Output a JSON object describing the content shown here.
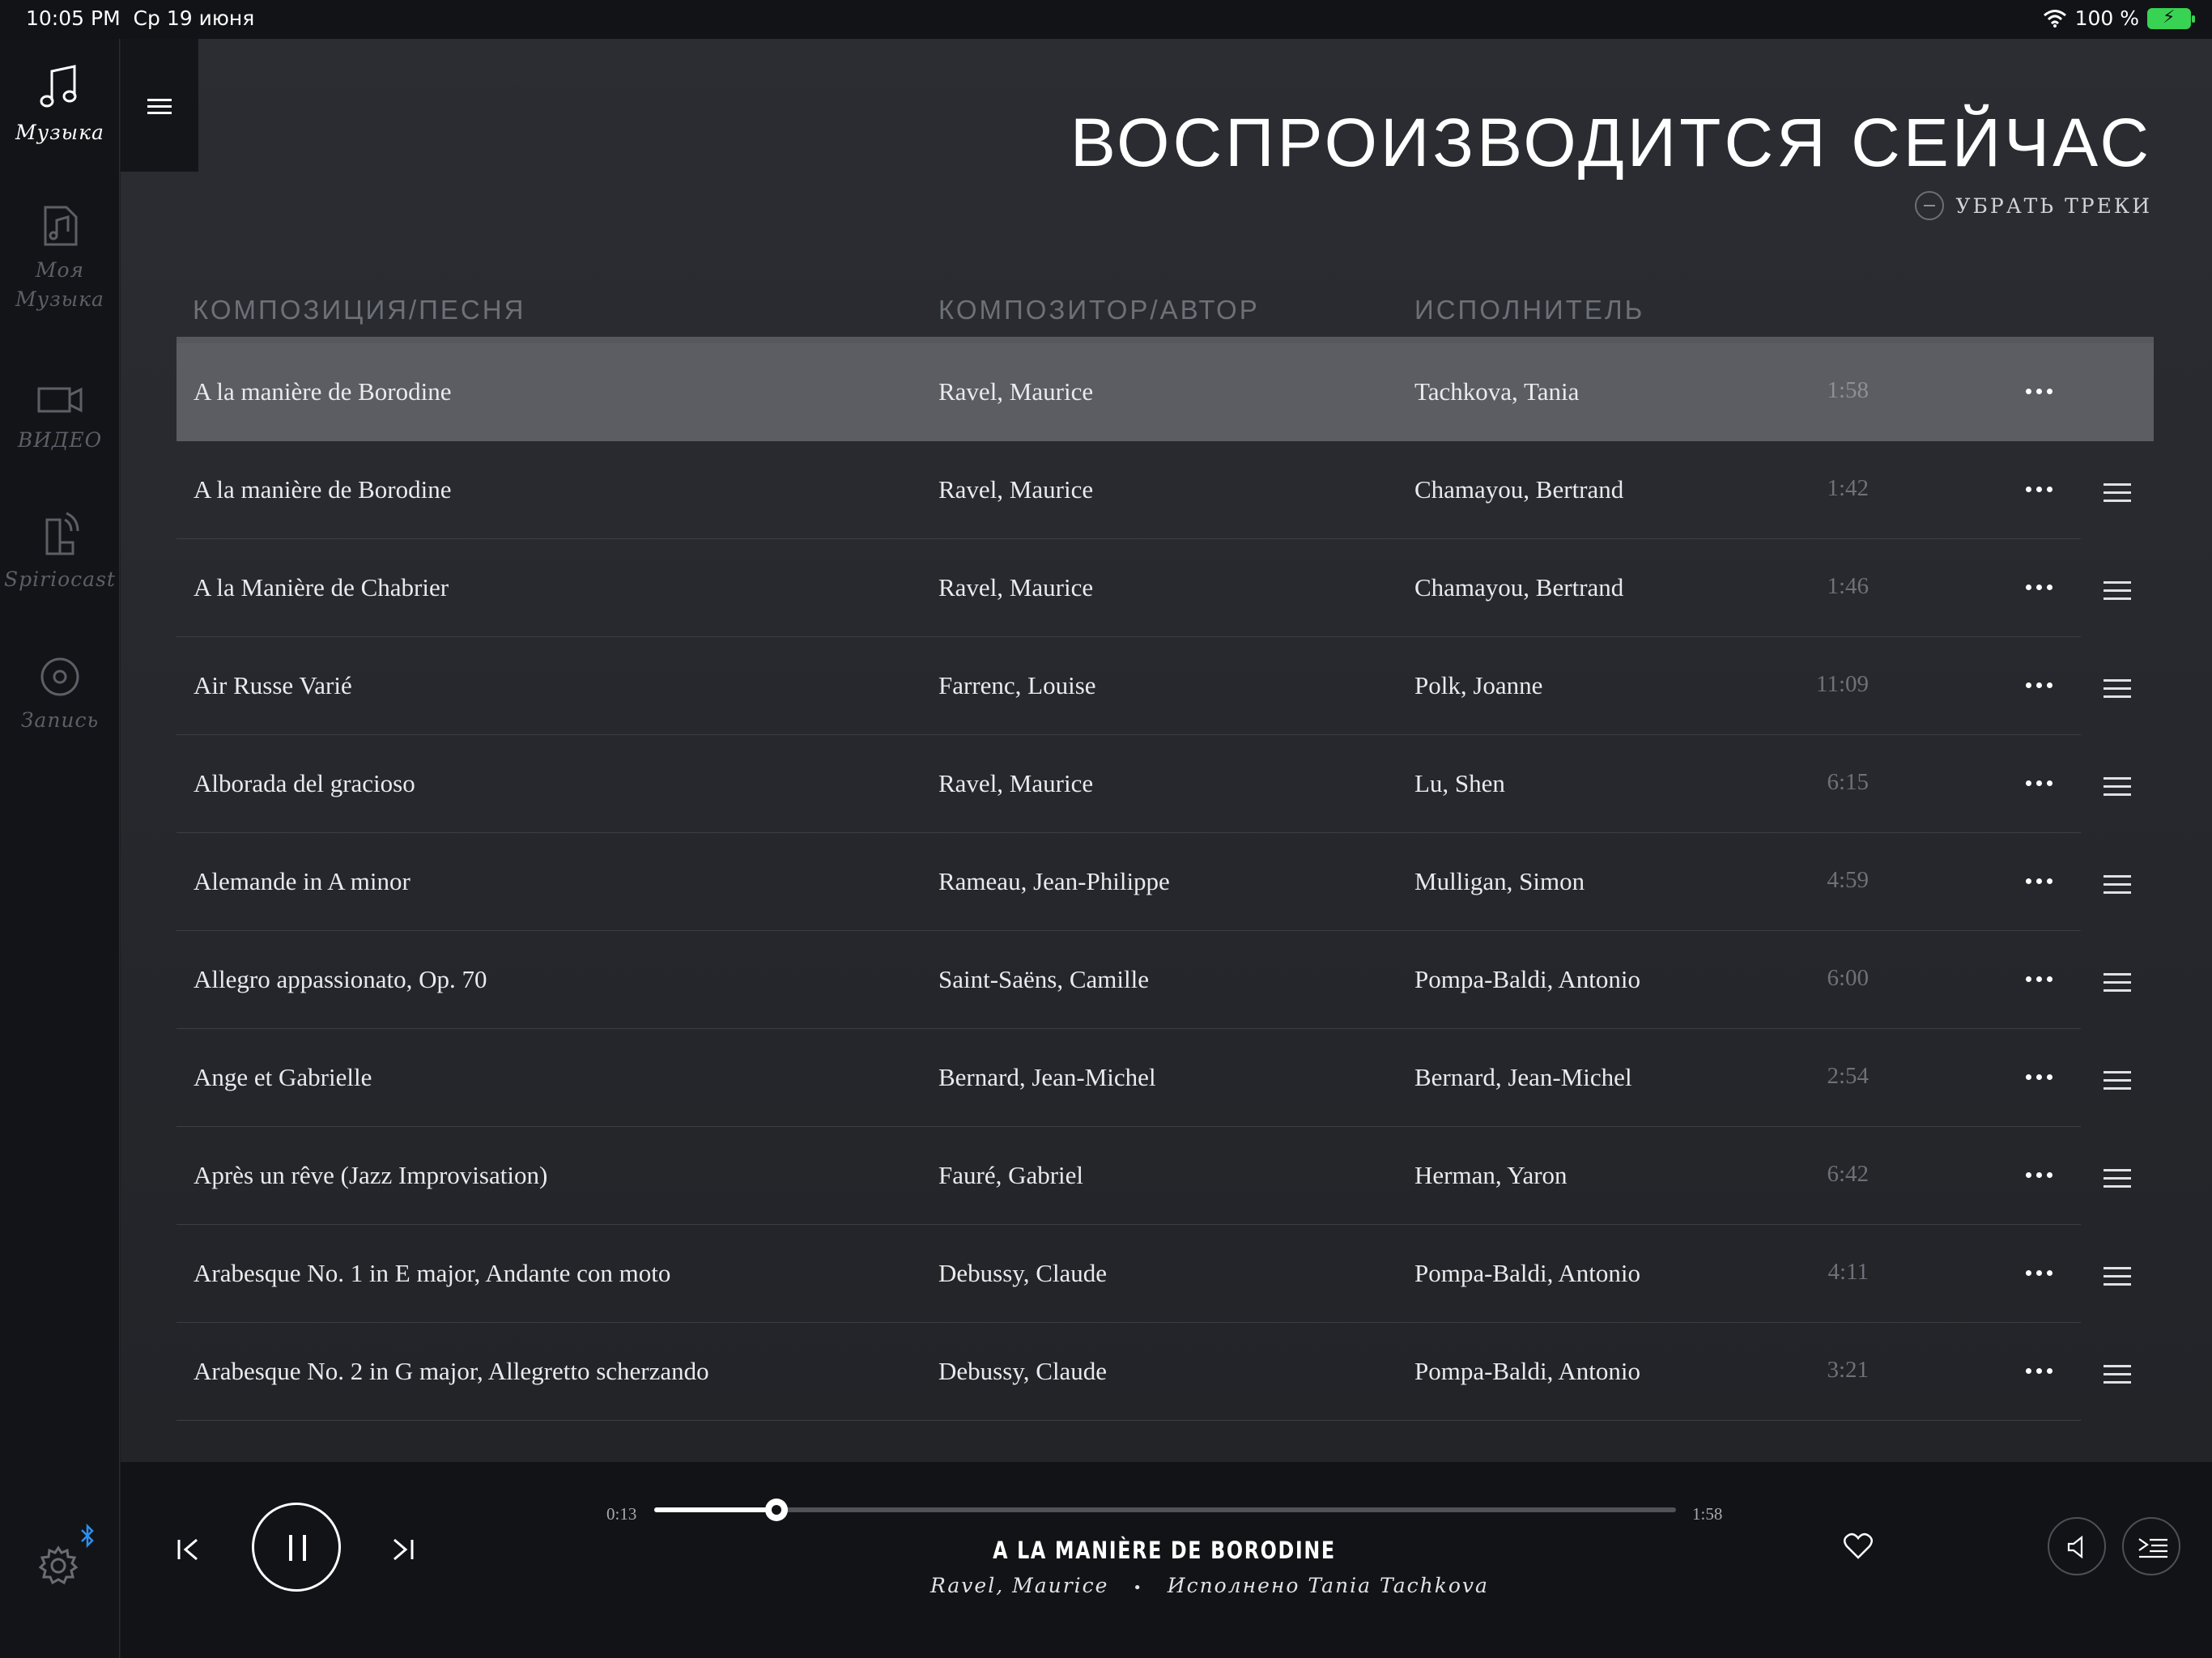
{
  "status_bar": {
    "time": "10:05 PM",
    "date": "Ср 19 июня",
    "battery": "100 %"
  },
  "sidebar": {
    "items": [
      {
        "label": "Музыка",
        "icon": "music-note-icon",
        "active": true
      },
      {
        "label": "Моя Музыка",
        "icon": "my-music-icon",
        "active": false
      },
      {
        "label": "ВИДЕО",
        "icon": "video-camera-icon",
        "active": false
      },
      {
        "label": "Spiriocast",
        "icon": "spiriocast-icon",
        "active": false
      },
      {
        "label": "Запись",
        "icon": "record-icon",
        "active": false
      }
    ],
    "settings_icon": "gear-icon",
    "bluetooth_icon": "bluetooth-icon"
  },
  "header": {
    "title": "ВОСПРОИЗВОДИТСЯ СЕЙЧАС",
    "remove_label": "УБРАТЬ ТРЕКИ"
  },
  "table": {
    "columns": {
      "song": "КОМПОЗИЦИЯ/ПЕСНЯ",
      "composer": "КОМПОЗИТОР/АВТОР",
      "artist": "ИСПОЛНИТЕЛЬ"
    },
    "rows": [
      {
        "song": "A la manière de Borodine",
        "composer": "Ravel, Maurice",
        "artist": "Tachkova, Tania",
        "duration": "1:58",
        "current": true
      },
      {
        "song": "A la manière de Borodine",
        "composer": "Ravel, Maurice",
        "artist": "Chamayou, Bertrand",
        "duration": "1:42",
        "current": false
      },
      {
        "song": "A la Manière de Chabrier",
        "composer": "Ravel, Maurice",
        "artist": "Chamayou, Bertrand",
        "duration": "1:46",
        "current": false
      },
      {
        "song": "Air Russe Varié",
        "composer": "Farrenc, Louise",
        "artist": "Polk, Joanne",
        "duration": "11:09",
        "current": false
      },
      {
        "song": "Alborada del gracioso",
        "composer": "Ravel, Maurice",
        "artist": "Lu, Shen",
        "duration": "6:15",
        "current": false
      },
      {
        "song": "Alemande in A minor",
        "composer": "Rameau, Jean-Philippe",
        "artist": "Mulligan, Simon",
        "duration": "4:59",
        "current": false
      },
      {
        "song": "Allegro appassionato, Op. 70",
        "composer": "Saint-Saëns, Camille",
        "artist": "Pompa-Baldi, Antonio",
        "duration": "6:00",
        "current": false
      },
      {
        "song": "Ange et Gabrielle",
        "composer": "Bernard, Jean-Michel",
        "artist": "Bernard, Jean-Michel",
        "duration": "2:54",
        "current": false
      },
      {
        "song": "Après un rêve (Jazz Improvisation)",
        "composer": "Fauré, Gabriel",
        "artist": "Herman, Yaron",
        "duration": "6:42",
        "current": false
      },
      {
        "song": "Arabesque No. 1 in E major, Andante con moto",
        "composer": "Debussy, Claude",
        "artist": "Pompa-Baldi, Antonio",
        "duration": "4:11",
        "current": false
      },
      {
        "song": "Arabesque No. 2 in G major, Allegretto scherzando",
        "composer": "Debussy, Claude",
        "artist": "Pompa-Baldi, Antonio",
        "duration": "3:21",
        "current": false
      }
    ]
  },
  "player": {
    "elapsed": "0:13",
    "total": "1:58",
    "progress": 0.12,
    "title": "A LA MANIÈRE DE BORODINE",
    "composer": "Ravel, Maurice",
    "separator": "•",
    "performed_by": "Исполнено Tania Tachkova"
  }
}
